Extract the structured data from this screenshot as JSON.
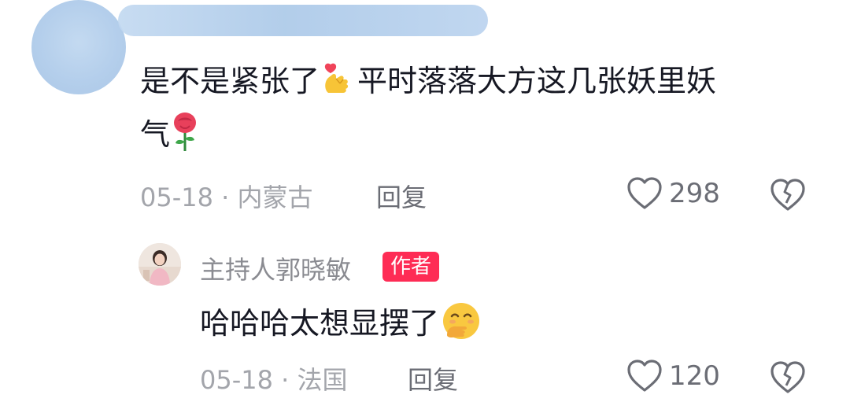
{
  "comments": [
    {
      "text_line1": "是不是紧张了",
      "emoji1": "finger-heart-emoji",
      "text_line1b": "平时落落大方这几张妖里妖",
      "text_line2": "气",
      "emoji2": "rose-emoji",
      "date": "05-18",
      "separator": "·",
      "location": "内蒙古",
      "reply_label": "回复",
      "like_count": "298"
    },
    {
      "author": "主持人郭晓敏",
      "author_badge": "作者",
      "text": "哈哈哈太想显摆了",
      "emoji": "hand-over-mouth-emoji",
      "date": "05-18",
      "separator": "·",
      "location": "法国",
      "reply_label": "回复",
      "like_count": "120"
    }
  ],
  "colors": {
    "badge": "#fe2c55",
    "meta": "#a3a5ab",
    "text": "#161823"
  }
}
